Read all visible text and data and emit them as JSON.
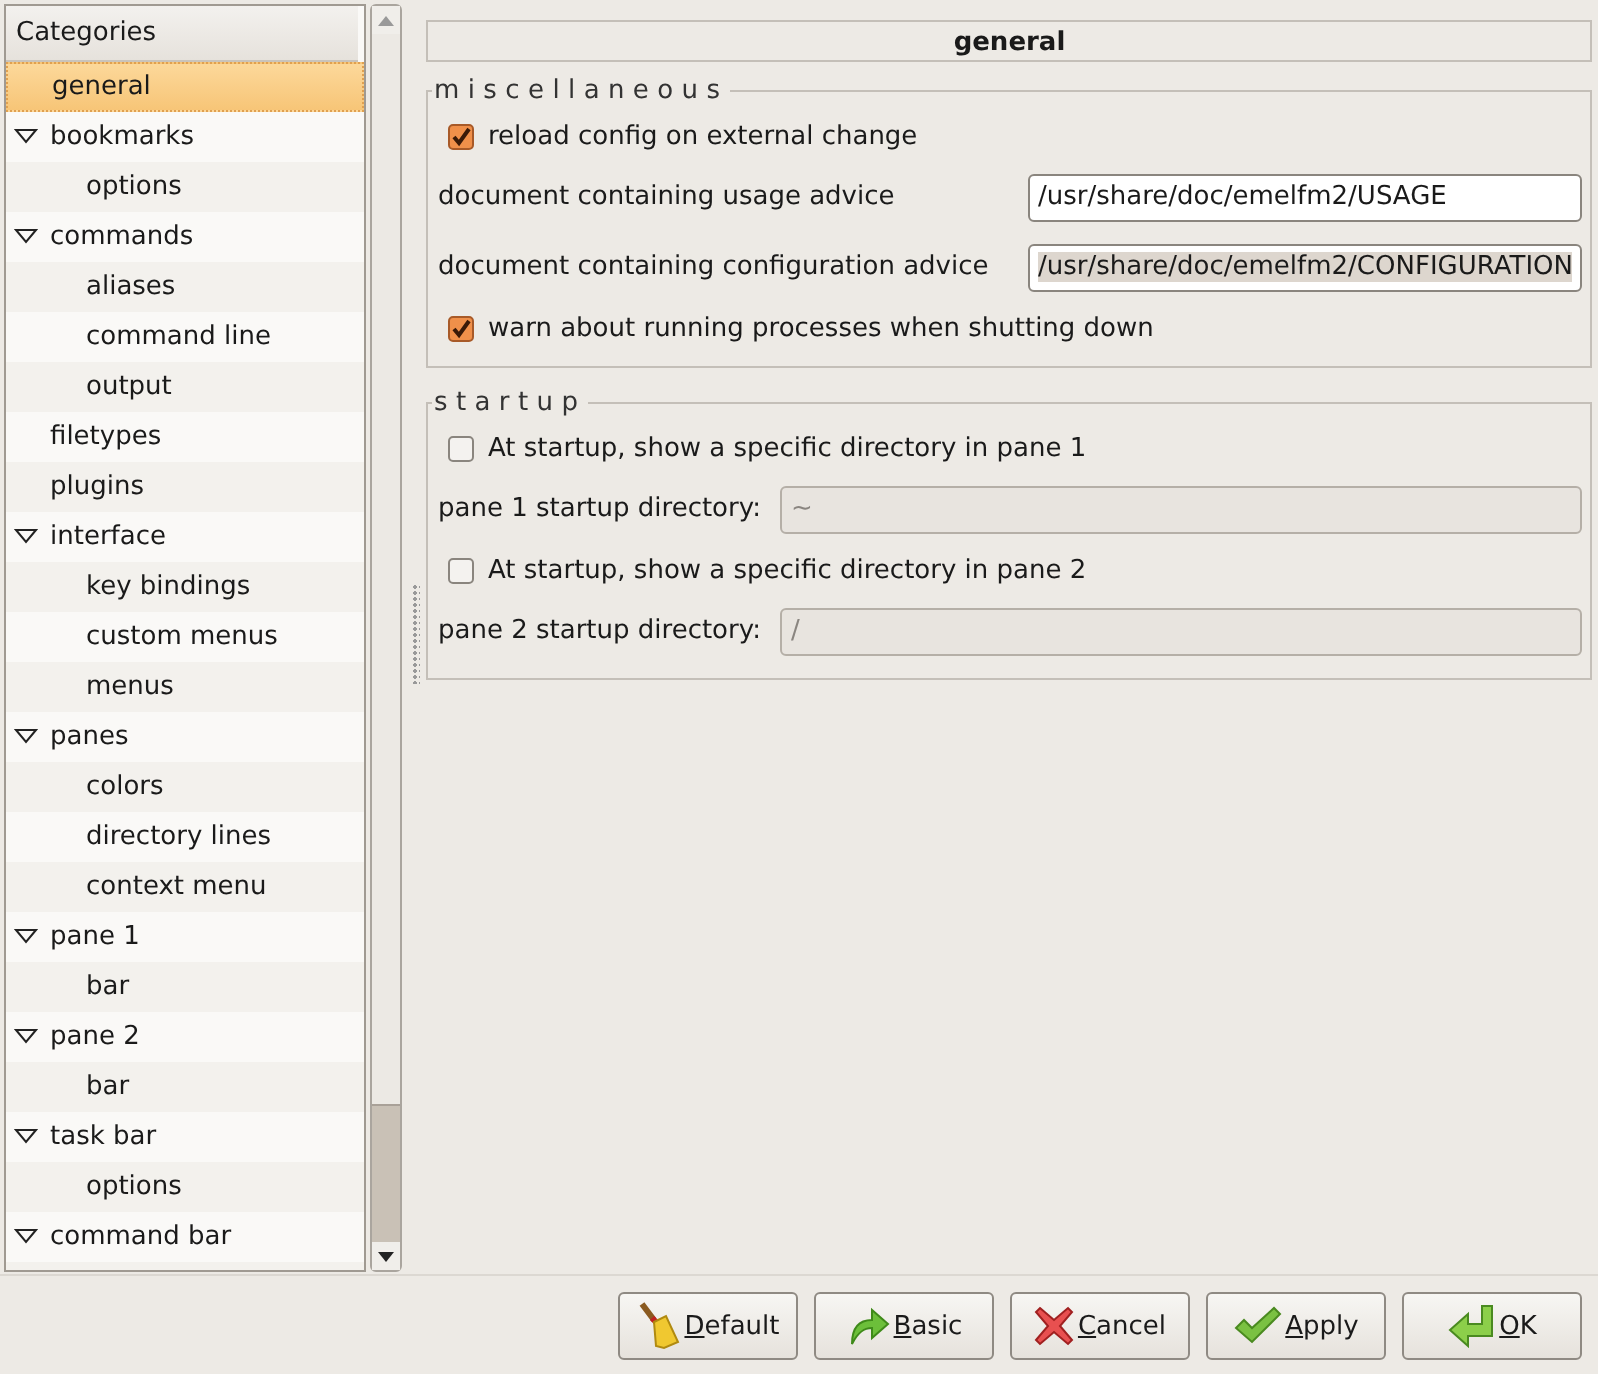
{
  "sidebar": {
    "header": "Categories",
    "items": [
      {
        "label": "general",
        "selected": true
      },
      {
        "label": "bookmarks",
        "selected": false,
        "expanded": true,
        "children": [
          {
            "label": "options",
            "selected": false
          }
        ]
      },
      {
        "label": "commands",
        "selected": false,
        "expanded": true,
        "children": [
          {
            "label": "aliases",
            "selected": false
          },
          {
            "label": "command line",
            "selected": false
          },
          {
            "label": "output",
            "selected": false
          }
        ]
      },
      {
        "label": "filetypes",
        "selected": false
      },
      {
        "label": "plugins",
        "selected": false
      },
      {
        "label": "interface",
        "selected": false,
        "expanded": true,
        "children": [
          {
            "label": "key bindings",
            "selected": false
          },
          {
            "label": "custom menus",
            "selected": false
          },
          {
            "label": "menus",
            "selected": false
          }
        ]
      },
      {
        "label": "panes",
        "selected": false,
        "expanded": true,
        "children": [
          {
            "label": "colors",
            "selected": false
          },
          {
            "label": "directory lines",
            "selected": false
          },
          {
            "label": "context menu",
            "selected": false
          }
        ]
      },
      {
        "label": "pane 1",
        "selected": false,
        "expanded": true,
        "children": [
          {
            "label": "bar",
            "selected": false
          }
        ]
      },
      {
        "label": "pane 2",
        "selected": false,
        "expanded": true,
        "children": [
          {
            "label": "bar",
            "selected": false
          }
        ]
      },
      {
        "label": "task bar",
        "selected": false,
        "expanded": true,
        "children": [
          {
            "label": "options",
            "selected": false
          }
        ]
      },
      {
        "label": "command bar",
        "selected": false,
        "expanded": true
      }
    ]
  },
  "panel": {
    "title": "general",
    "sections": [
      {
        "legend": "miscellaneous",
        "rows": [
          {
            "kind": "checkbox",
            "text": "reload config on external change",
            "checked": true
          },
          {
            "kind": "field",
            "label": "document containing usage advice",
            "value": "/usr/share/doc/emelfm2/USAGE",
            "disabled": false,
            "text_selected": false
          },
          {
            "kind": "field",
            "label": "document containing configuration advice",
            "value": "/usr/share/doc/emelfm2/CONFIGURATION",
            "disabled": false,
            "text_selected": true
          },
          {
            "kind": "checkbox",
            "text": "warn about running processes when shutting down",
            "checked": true
          }
        ]
      },
      {
        "legend": "startup",
        "rows": [
          {
            "kind": "checkbox",
            "text": "At startup, show a specific directory in pane 1",
            "checked": false
          },
          {
            "kind": "field",
            "label": "pane 1 startup directory:",
            "value": "~",
            "disabled": true,
            "text_selected": false
          },
          {
            "kind": "checkbox",
            "text": "At startup, show a specific directory in pane 2",
            "checked": false
          },
          {
            "kind": "field",
            "label": "pane 2 startup directory:",
            "value": "/",
            "disabled": true,
            "text_selected": false
          }
        ]
      }
    ]
  },
  "buttons": [
    "Default",
    "Basic",
    "Cancel",
    "Apply",
    "OK"
  ]
}
